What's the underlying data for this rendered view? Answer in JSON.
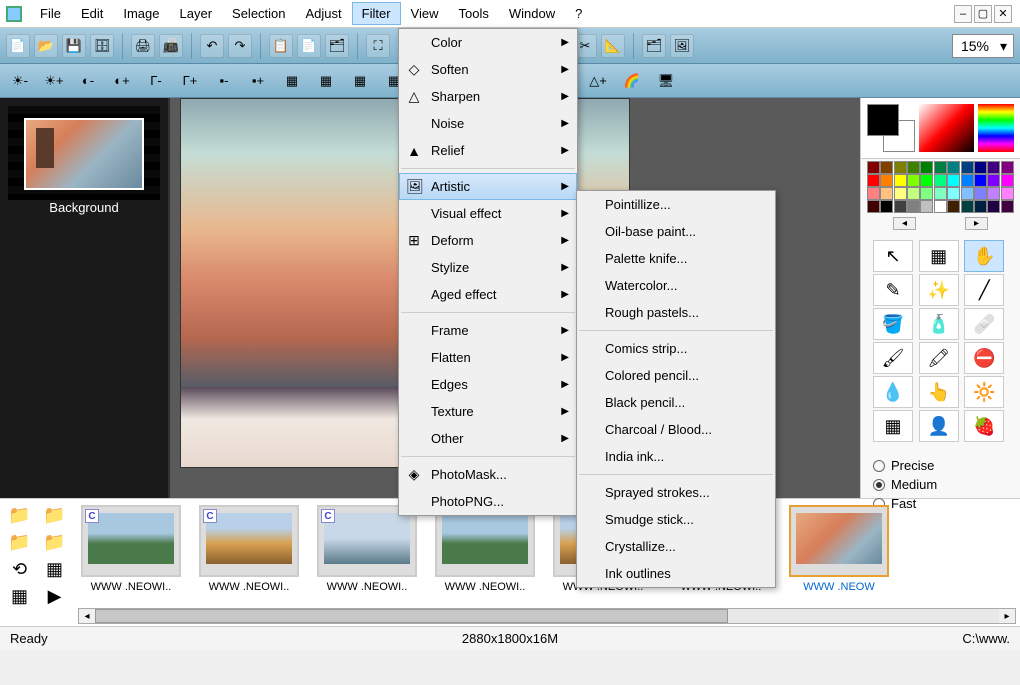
{
  "menubar": {
    "items": [
      "File",
      "Edit",
      "Image",
      "Layer",
      "Selection",
      "Adjust",
      "Filter",
      "View",
      "Tools",
      "Window",
      "?"
    ],
    "active_index": 6
  },
  "zoom": "15%",
  "filter_menu": {
    "items": [
      {
        "label": "Color",
        "arrow": true,
        "icon": ""
      },
      {
        "label": "Soften",
        "arrow": true,
        "icon": "◇"
      },
      {
        "label": "Sharpen",
        "arrow": true,
        "icon": "△"
      },
      {
        "label": "Noise",
        "arrow": true,
        "icon": ""
      },
      {
        "label": "Relief",
        "arrow": true,
        "icon": "▲"
      },
      {
        "sep": true
      },
      {
        "label": "Artistic",
        "arrow": true,
        "icon": "🖼",
        "highlighted": true
      },
      {
        "label": "Visual effect",
        "arrow": true,
        "icon": ""
      },
      {
        "label": "Deform",
        "arrow": true,
        "icon": "⊞"
      },
      {
        "label": "Stylize",
        "arrow": true,
        "icon": ""
      },
      {
        "label": "Aged effect",
        "arrow": true,
        "icon": ""
      },
      {
        "sep": true
      },
      {
        "label": "Frame",
        "arrow": true,
        "icon": ""
      },
      {
        "label": "Flatten",
        "arrow": true,
        "icon": ""
      },
      {
        "label": "Edges",
        "arrow": true,
        "icon": ""
      },
      {
        "label": "Texture",
        "arrow": true,
        "icon": ""
      },
      {
        "label": "Other",
        "arrow": true,
        "icon": ""
      },
      {
        "sep": true
      },
      {
        "label": "PhotoMask...",
        "arrow": false,
        "icon": "◈"
      },
      {
        "label": "PhotoPNG...",
        "arrow": false,
        "icon": ""
      }
    ]
  },
  "artistic_submenu": {
    "items": [
      {
        "label": "Pointillize..."
      },
      {
        "label": "Oil-base paint..."
      },
      {
        "label": "Palette knife..."
      },
      {
        "label": "Watercolor..."
      },
      {
        "label": "Rough pastels..."
      },
      {
        "sep": true
      },
      {
        "label": "Comics strip..."
      },
      {
        "label": "Colored pencil..."
      },
      {
        "label": "Black pencil..."
      },
      {
        "label": "Charcoal / Blood..."
      },
      {
        "label": "India ink..."
      },
      {
        "sep": true
      },
      {
        "label": "Sprayed strokes..."
      },
      {
        "label": "Smudge stick..."
      },
      {
        "label": "Crystallize..."
      },
      {
        "label": "Ink outlines"
      }
    ]
  },
  "layers": {
    "item0": "Background"
  },
  "palette_colors": [
    "#800000",
    "#804000",
    "#808000",
    "#408000",
    "#008000",
    "#008040",
    "#008080",
    "#004080",
    "#000080",
    "#400080",
    "#800080",
    "#ff0000",
    "#ff8000",
    "#ffff00",
    "#80ff00",
    "#00ff00",
    "#00ff80",
    "#00ffff",
    "#0080ff",
    "#0000ff",
    "#8000ff",
    "#ff00ff",
    "#ff8080",
    "#ffc080",
    "#ffff80",
    "#c0ff80",
    "#80ff80",
    "#80ffc0",
    "#80ffff",
    "#80c0ff",
    "#8080ff",
    "#c080ff",
    "#ff80ff",
    "#400000",
    "#000000",
    "#404040",
    "#808080",
    "#c0c0c0",
    "#ffffff",
    "#402000",
    "#004040",
    "#002040",
    "#200040",
    "#400040"
  ],
  "tools": {
    "icons": [
      "↖",
      "▦",
      "✋",
      "✎",
      "✨",
      "╱",
      "🪣",
      "🧴",
      "🩹",
      "🖌",
      "🖍",
      "⛔",
      "💧",
      "👆",
      "🔆",
      "▦",
      "👤",
      "🍓"
    ],
    "names": [
      "pointer-tool",
      "selection-tool",
      "hand-tool",
      "eyedropper-tool",
      "wand-tool",
      "line-tool",
      "fill-tool",
      "spray-tool",
      "eraser-tool",
      "brush-tool",
      "pencil-tool",
      "stamp-tool",
      "blur-tool",
      "smudge-tool",
      "dodge-tool",
      "grid-tool",
      "portrait-tool",
      "redeye-tool"
    ],
    "active_index": 2
  },
  "quality": {
    "options": [
      "Precise",
      "Medium",
      "Fast"
    ],
    "selected_index": 1
  },
  "browser": {
    "thumbs": [
      {
        "caption": "WWW .NEOWI..",
        "badge": "C"
      },
      {
        "caption": "WWW .NEOWI..",
        "badge": "C"
      },
      {
        "caption": "WWW .NEOWI..",
        "badge": "C"
      },
      {
        "caption": "WWW .NEOWI..",
        "badge": ""
      },
      {
        "caption": "WWW .NEOWI..",
        "badge": ""
      },
      {
        "caption": "WWW .NEOWI..",
        "badge": ""
      },
      {
        "caption": "WWW .NEOW",
        "badge": "",
        "selected": true
      }
    ]
  },
  "statusbar": {
    "left": "Ready",
    "center": "2880x1800x16M",
    "right": "C:\\www."
  }
}
